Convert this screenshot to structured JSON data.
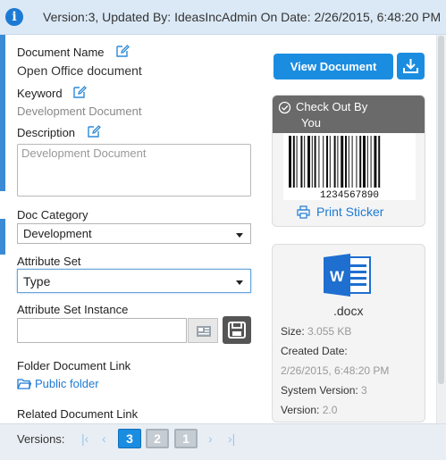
{
  "banner": {
    "text": "Version:3, Updated By: IdeasIncAdmin On Date: 2/26/2015, 6:48:20 PM"
  },
  "fields": {
    "document_name_label": "Document Name",
    "document_name_value": "Open Office document",
    "keyword_label": "Keyword",
    "keyword_value": "Development Document",
    "description_label": "Description",
    "description_value": "Development Document",
    "doc_category_label": "Doc Category",
    "doc_category_value": "Development",
    "attribute_set_label": "Attribute Set",
    "attribute_set_value": "Type",
    "attribute_set_instance_label": "Attribute Set Instance",
    "attribute_set_instance_value": "",
    "folder_link_label": "Folder Document Link",
    "folder_link_value": "Public folder",
    "related_link_label": "Related Document Link"
  },
  "actions": {
    "view_document": "View Document",
    "print_sticker": "Print Sticker"
  },
  "checkout": {
    "line1": "Check Out By",
    "line2": "You",
    "barcode_number": "1234567890"
  },
  "file": {
    "extension": ".docx",
    "size_label": "Size:",
    "size_value": "3.055 KB",
    "created_label": "Created Date:",
    "created_value": "2/26/2015, 6:48:20 PM",
    "system_version_label": "System Version:",
    "system_version_value": "3",
    "version_label": "Version:",
    "version_value": "2.0"
  },
  "versions": {
    "label": "Versions:",
    "pages": [
      "3",
      "2",
      "1"
    ],
    "active": "3"
  },
  "colors": {
    "accent": "#1b8de1",
    "banner_bg": "#dbe9f6",
    "word_blue": "#1e6fd0"
  },
  "icons": [
    "info-icon",
    "edit-icon",
    "download-icon",
    "check-circle-icon",
    "barcode-icon",
    "printer-icon",
    "word-file-icon",
    "folder-icon",
    "save-icon"
  ]
}
